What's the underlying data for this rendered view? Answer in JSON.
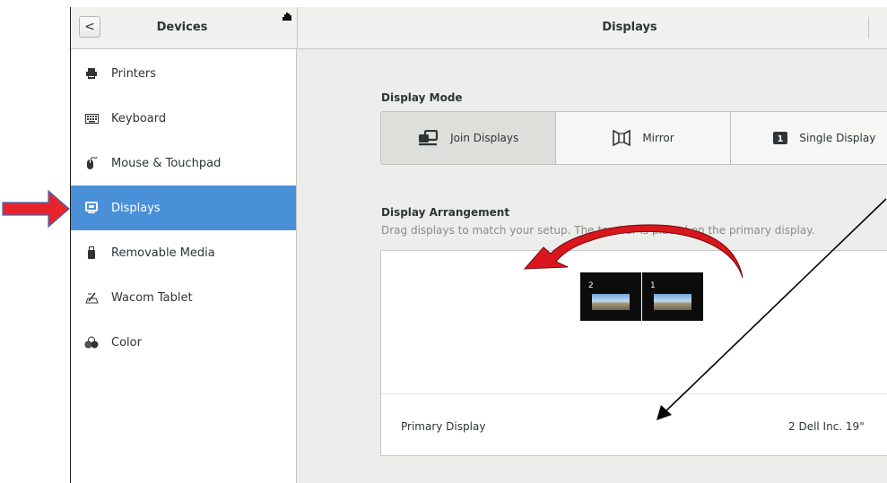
{
  "header": {
    "back_glyph": "<",
    "left_title": "Devices",
    "right_title": "Displays"
  },
  "sidebar": {
    "items": [
      {
        "label": "Printers",
        "icon": "printer-icon"
      },
      {
        "label": "Keyboard",
        "icon": "keyboard-icon"
      },
      {
        "label": "Mouse & Touchpad",
        "icon": "mouse-icon"
      },
      {
        "label": "Displays",
        "icon": "display-icon",
        "active": true
      },
      {
        "label": "Removable Media",
        "icon": "usb-icon"
      },
      {
        "label": "Wacom Tablet",
        "icon": "tablet-icon"
      },
      {
        "label": "Color",
        "icon": "color-icon"
      }
    ]
  },
  "display_mode": {
    "label": "Display Mode",
    "options": [
      {
        "label": "Join Displays",
        "icon": "join-displays-icon",
        "selected": true
      },
      {
        "label": "Mirror",
        "icon": "mirror-icon"
      },
      {
        "label": "Single Display",
        "icon": "single-display-icon",
        "badge": "1"
      }
    ]
  },
  "arrangement": {
    "label": "Display Arrangement",
    "hint": "Drag displays to match your setup. The top bar is placed on the primary display.",
    "monitors": [
      {
        "number": "2"
      },
      {
        "number": "1"
      }
    ],
    "primary_label": "Primary Display",
    "primary_value": "2   Dell Inc. 19\""
  },
  "colors": {
    "accent": "#4a90d9",
    "annotation_red": "#e8242b"
  }
}
